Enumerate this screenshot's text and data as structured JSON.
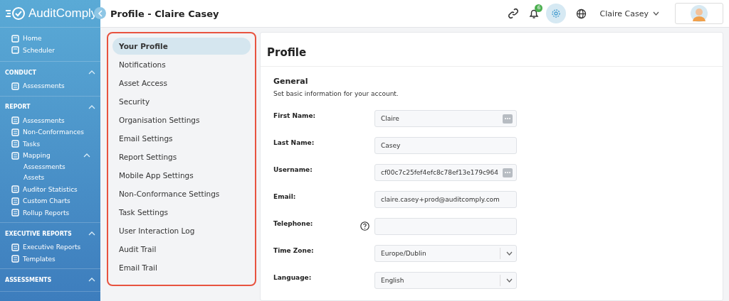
{
  "sidebar": {
    "logo": "AuditComply",
    "top_items": [
      {
        "label": "Home"
      },
      {
        "label": "Scheduler"
      }
    ],
    "sections": [
      {
        "title": "CONDUCT",
        "expanded": true,
        "items": [
          {
            "label": "Assessments"
          }
        ]
      },
      {
        "title": "REPORT",
        "expanded": true,
        "items": [
          {
            "label": "Assessments"
          },
          {
            "label": "Non-Conformances"
          },
          {
            "label": "Tasks"
          },
          {
            "label": "Mapping",
            "expanded": true,
            "children": [
              {
                "label": "Assessments"
              },
              {
                "label": "Assets"
              }
            ]
          },
          {
            "label": "Auditor Statistics"
          },
          {
            "label": "Custom Charts"
          },
          {
            "label": "Rollup Reports"
          }
        ]
      },
      {
        "title": "EXECUTIVE REPORTS",
        "expanded": true,
        "items": [
          {
            "label": "Executive Reports"
          },
          {
            "label": "Templates"
          }
        ]
      },
      {
        "title": "ASSESSMENTS",
        "expanded": true
      }
    ]
  },
  "header": {
    "title": "Profile - Claire Casey",
    "notification_count": "6",
    "user_name": "Claire Casey"
  },
  "settings_nav": [
    {
      "label": "Your Profile",
      "selected": true
    },
    {
      "label": "Notifications",
      "selected": false
    },
    {
      "label": "Asset Access",
      "selected": false
    },
    {
      "label": "Security",
      "selected": false
    },
    {
      "label": "Organisation Settings",
      "selected": false
    },
    {
      "label": "Email Settings",
      "selected": false
    },
    {
      "label": "Report Settings",
      "selected": false
    },
    {
      "label": "Mobile App Settings",
      "selected": false
    },
    {
      "label": "Non-Conformance Settings",
      "selected": false
    },
    {
      "label": "Task Settings",
      "selected": false
    },
    {
      "label": "User Interaction Log",
      "selected": false
    },
    {
      "label": "Audit Trail",
      "selected": false
    },
    {
      "label": "Email Trail",
      "selected": false
    }
  ],
  "profile": {
    "title": "Profile",
    "section_title": "General",
    "section_description": "Set basic information for your account.",
    "fields": [
      {
        "label": "First Name:",
        "kind": "text",
        "value": "Claire",
        "more_button": true,
        "help": false
      },
      {
        "label": "Last Name:",
        "kind": "text",
        "value": "Casey",
        "more_button": false,
        "help": false
      },
      {
        "label": "Username:",
        "kind": "text",
        "value": "cf00c7c25fef4efc8c78ef13e179c964",
        "more_button": true,
        "help": false
      },
      {
        "label": "Email:",
        "kind": "text",
        "value": "claire.casey+prod@auditcomply.com",
        "more_button": false,
        "help": false
      },
      {
        "label": "Telephone:",
        "kind": "text",
        "more_button": false,
        "help": true
      },
      {
        "label": "Time Zone:",
        "kind": "select",
        "value": "Europe/Dublin",
        "help": false
      },
      {
        "label": "Language:",
        "kind": "select",
        "value": "English",
        "help": false
      }
    ]
  }
}
